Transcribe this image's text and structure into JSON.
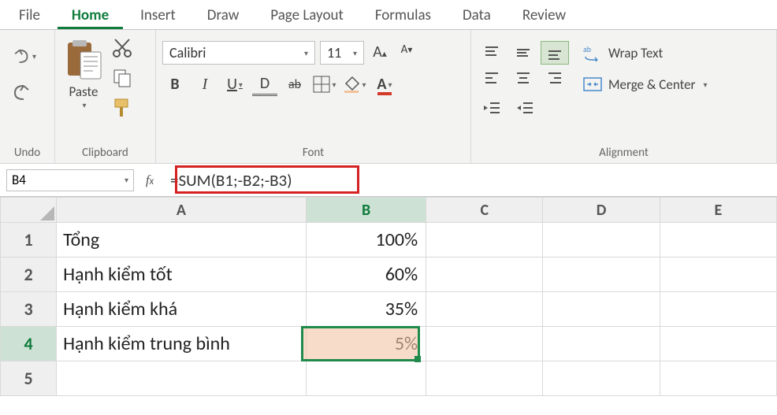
{
  "tabs": [
    "File",
    "Home",
    "Insert",
    "Draw",
    "Page Layout",
    "Formulas",
    "Data",
    "Review"
  ],
  "active_tab": 1,
  "ribbon": {
    "undo_group": "Undo",
    "clipboard": {
      "paste": "Paste",
      "label": "Clipboard"
    },
    "font": {
      "name": "Calibri",
      "size": "11",
      "label": "Font",
      "bold": "B",
      "italic": "I",
      "underline": "U",
      "dbl_underline": "D",
      "strike": "ab"
    },
    "alignment": {
      "label": "Alignment",
      "wrap": "Wrap Text",
      "merge": "Merge & Center"
    }
  },
  "name_box": "B4",
  "formula": "=SUM(B1;-B2;-B3)",
  "columns": [
    "A",
    "B",
    "C",
    "D",
    "E"
  ],
  "rows": [
    {
      "n": "1",
      "a": "Tổng",
      "b": "100%"
    },
    {
      "n": "2",
      "a": "Hạnh kiểm tốt",
      "b": "60%"
    },
    {
      "n": "3",
      "a": "Hạnh kiểm khá",
      "b": "35%"
    },
    {
      "n": "4",
      "a": "Hạnh kiểm trung bình",
      "b": "5%"
    },
    {
      "n": "5",
      "a": "",
      "b": ""
    }
  ],
  "selected": {
    "row": 4,
    "col": "B"
  }
}
